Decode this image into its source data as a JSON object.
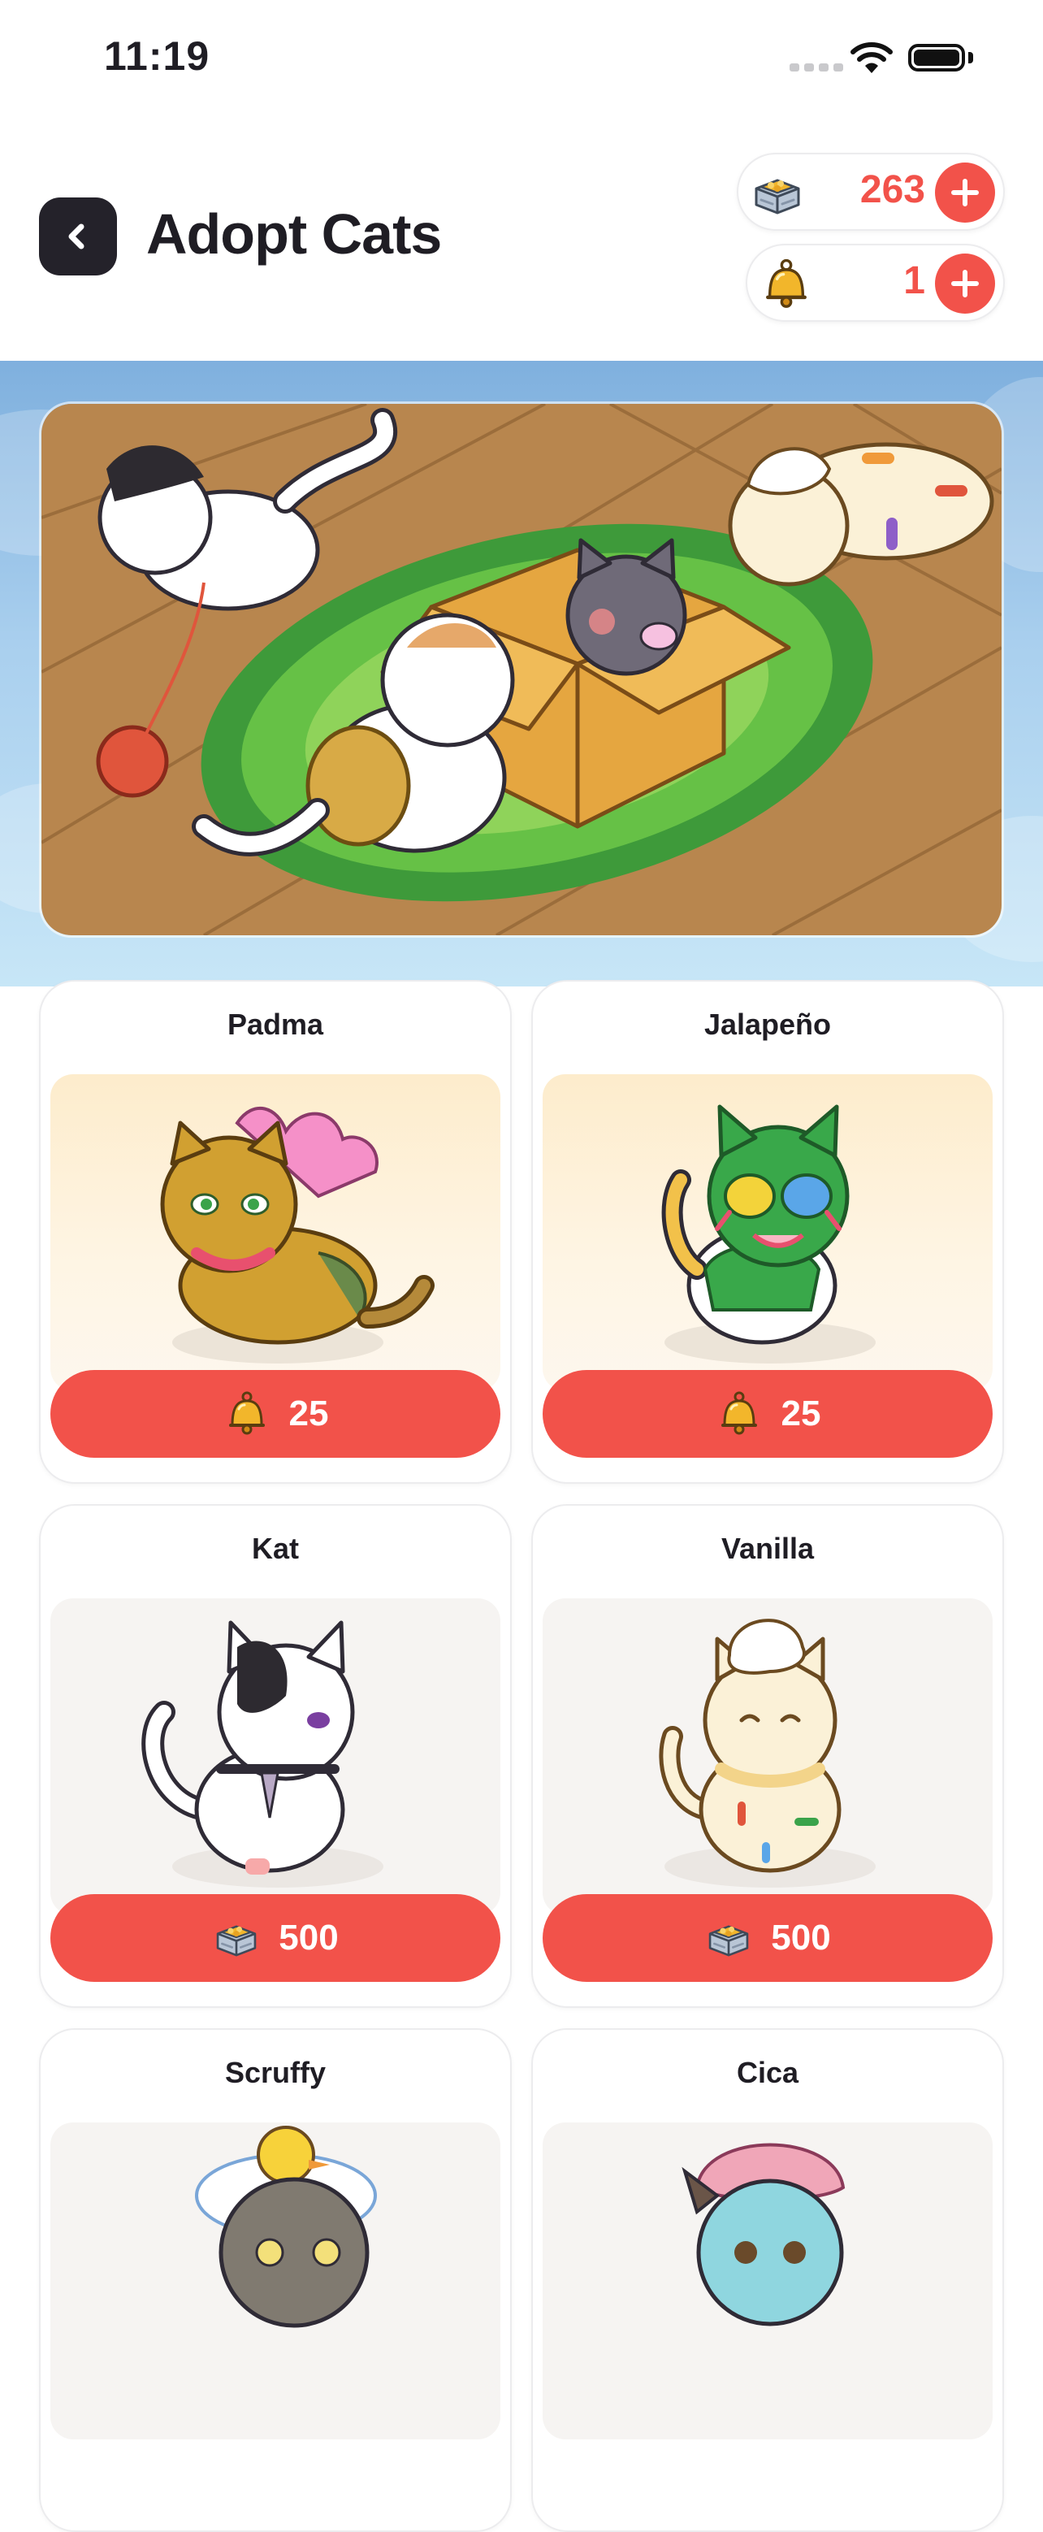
{
  "status_bar": {
    "time": "11:19"
  },
  "header": {
    "title": "Adopt Cats"
  },
  "currencies": [
    {
      "name": "Cat food tins",
      "icon": "food-tin-icon",
      "value": "263"
    },
    {
      "name": "Golden bells",
      "icon": "golden-bell-icon",
      "value": "1"
    }
  ],
  "colors": {
    "accent": "#f2524a",
    "dark": "#24222a",
    "banner": "#a9cfee"
  },
  "cats": [
    {
      "name": "Padma",
      "price": "25",
      "currency_icon": "golden-bell-icon"
    },
    {
      "name": "Jalapeño",
      "price": "25",
      "currency_icon": "golden-bell-icon"
    },
    {
      "name": "Kat",
      "price": "500",
      "currency_icon": "food-tin-icon"
    },
    {
      "name": "Vanilla",
      "price": "500",
      "currency_icon": "food-tin-icon"
    },
    {
      "name": "Scruffy"
    },
    {
      "name": "Cica"
    }
  ]
}
